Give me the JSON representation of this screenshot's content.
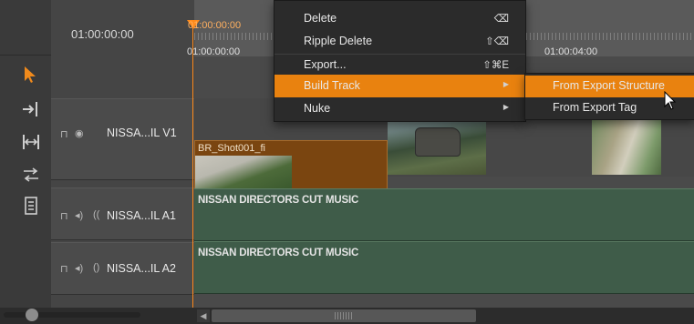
{
  "header": {
    "timecode": "01:00:00:00"
  },
  "ruler": {
    "playhead_tc": "01:00:00:00",
    "tc_start": "01:00:00:00",
    "tc_end": "01:00:04:00"
  },
  "tools": [
    {
      "name": "selection-tool-icon"
    },
    {
      "name": "track-select-tool-icon"
    },
    {
      "name": "ripple-edit-tool-icon"
    },
    {
      "name": "slip-tool-icon"
    },
    {
      "name": "slide-tool-icon"
    }
  ],
  "tracks": {
    "v1": {
      "label": "NISSA...IL V1"
    },
    "a1": {
      "label": "NISSA...IL A1"
    },
    "a2": {
      "label": "NISSA...IL A2"
    }
  },
  "clips": {
    "v1_clip1_name": "BR_Shot001_fi",
    "a1_name": "NISSAN DIRECTORS CUT MUSIC",
    "a2_name": "NISSAN DIRECTORS CUT MUSIC"
  },
  "menu": {
    "items": [
      {
        "label": "Delete",
        "shortcut": "⌫"
      },
      {
        "label": "Ripple Delete",
        "shortcut": "⇧⌫"
      },
      {
        "label": "Export...",
        "shortcut": "⇧⌘E"
      },
      {
        "label": "Build Track",
        "shortcut": ""
      },
      {
        "label": "Nuke",
        "shortcut": ""
      }
    ],
    "highlighted": "Build Track"
  },
  "submenu": {
    "items": [
      {
        "label": "From Export Structure"
      },
      {
        "label": "From Export Tag"
      }
    ],
    "highlighted": "From Export Structure"
  },
  "colors": {
    "accent": "#e9820f",
    "playhead": "#ff8a1a",
    "audio_lane": "#3f5c49"
  }
}
